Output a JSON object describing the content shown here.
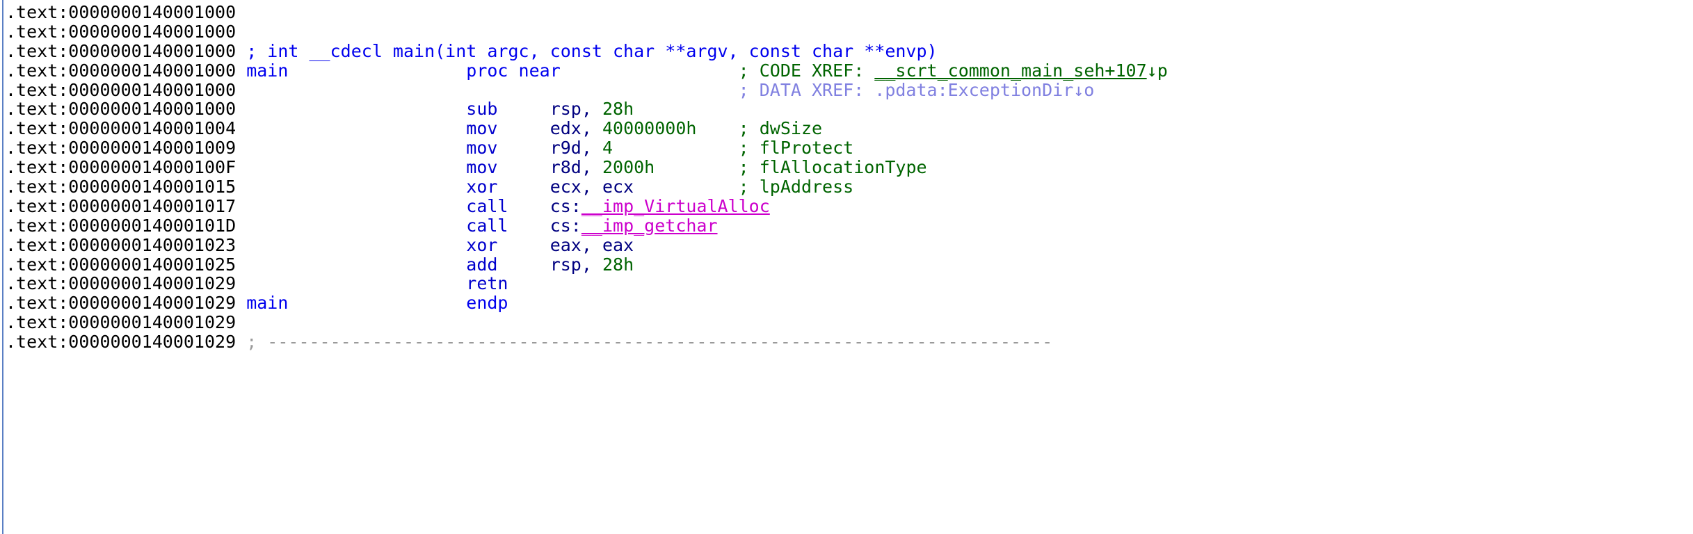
{
  "view": {
    "title": "IDA Pro disassembly view",
    "segment_prefix": ".text:",
    "background_color": "#ffffff",
    "gutter_color": "#5a7fc4"
  },
  "colors": {
    "address": "#000000",
    "symbol": "#0000ee",
    "mnemonic": "#0000cd",
    "register": "#000080",
    "number": "#006400",
    "comment": "#006400",
    "comment_blue": "#0000ee",
    "data_xref": "#8080e0",
    "import": "#cc00cc",
    "separator": "#9a9a9a"
  },
  "lines": [
    {
      "address": ".text:0000000140001000",
      "kind": "blank",
      "text": ""
    },
    {
      "address": ".text:0000000140001000",
      "kind": "blank",
      "text": ""
    },
    {
      "address": ".text:0000000140001000",
      "kind": "prototype",
      "comment": "; int __cdecl main(int argc, const char **argv, const char **envp)"
    },
    {
      "address": ".text:0000000140001000",
      "kind": "proc_start",
      "label": "main",
      "directive": "proc near",
      "comment_marker": ";",
      "comment_prefix": " CODE XREF: ",
      "xref": "__scrt_common_main_seh+107",
      "xref_suffix": "↓p"
    },
    {
      "address": ".text:0000000140001000",
      "kind": "data_xref",
      "comment": "; DATA XREF: .pdata:ExceptionDir↓o"
    },
    {
      "address": ".text:0000000140001000",
      "kind": "instruction",
      "mnemonic": "sub",
      "operands": "rsp, 28h",
      "op_reg": "rsp, ",
      "op_num": "28h",
      "comment": ""
    },
    {
      "address": ".text:0000000140001004",
      "kind": "instruction",
      "mnemonic": "mov",
      "operands": "edx, 40000000h",
      "op_reg": "edx, ",
      "op_num": "40000000h",
      "comment": "; dwSize"
    },
    {
      "address": ".text:0000000140001009",
      "kind": "instruction",
      "mnemonic": "mov",
      "operands": "r9d, 4",
      "op_reg": "r9d, ",
      "op_num": "4",
      "comment": "; flProtect"
    },
    {
      "address": ".text:000000014000100F",
      "kind": "instruction",
      "mnemonic": "mov",
      "operands": "r8d, 2000h",
      "op_reg": "r8d, ",
      "op_num": "2000h",
      "comment": "; flAllocationType"
    },
    {
      "address": ".text:0000000140001015",
      "kind": "instruction",
      "mnemonic": "xor",
      "operands": "ecx, ecx",
      "op_reg": "ecx, ecx",
      "op_num": "",
      "comment": "; lpAddress"
    },
    {
      "address": ".text:0000000140001017",
      "kind": "call",
      "mnemonic": "call",
      "cs_prefix": "cs:",
      "import": "__imp_VirtualAlloc",
      "comment": ""
    },
    {
      "address": ".text:000000014000101D",
      "kind": "call",
      "mnemonic": "call",
      "cs_prefix": "cs:",
      "import": "__imp_getchar",
      "comment": ""
    },
    {
      "address": ".text:0000000140001023",
      "kind": "instruction",
      "mnemonic": "xor",
      "operands": "eax, eax",
      "op_reg": "eax, eax",
      "op_num": "",
      "comment": ""
    },
    {
      "address": ".text:0000000140001025",
      "kind": "instruction",
      "mnemonic": "add",
      "operands": "rsp, 28h",
      "op_reg": "rsp, ",
      "op_num": "28h",
      "comment": ""
    },
    {
      "address": ".text:0000000140001029",
      "kind": "instruction",
      "mnemonic": "retn",
      "operands": "",
      "op_reg": "",
      "op_num": "",
      "comment": ""
    },
    {
      "address": ".text:0000000140001029",
      "kind": "proc_end",
      "label": "main",
      "directive": "endp"
    },
    {
      "address": ".text:0000000140001029",
      "kind": "blank",
      "text": ""
    },
    {
      "address": ".text:0000000140001029",
      "kind": "separator",
      "text": "; ---------------------------------------------------------------------------"
    }
  ]
}
